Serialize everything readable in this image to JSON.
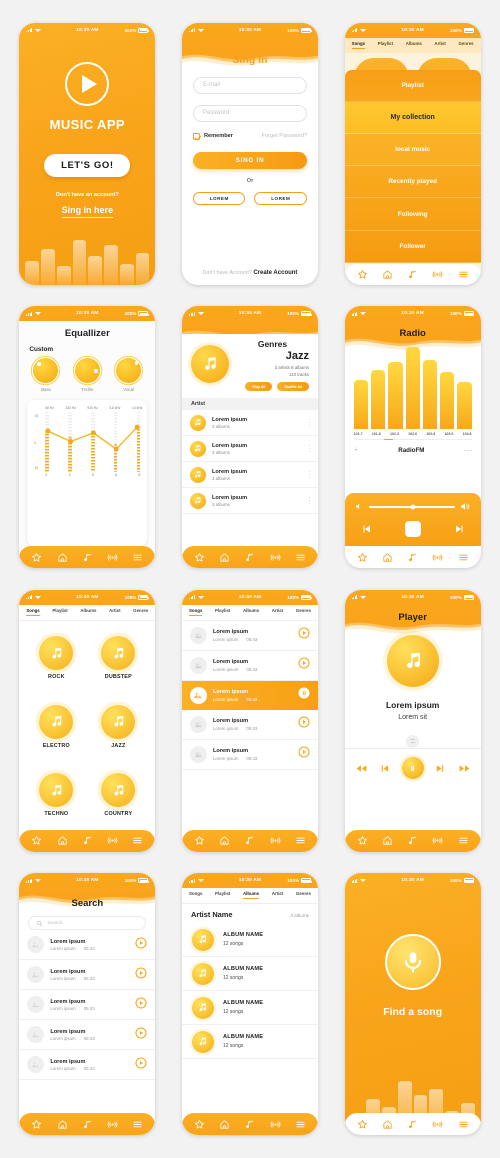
{
  "status_bar": {
    "time": "10:30 AM",
    "battery": "100%"
  },
  "nav": {
    "items": [
      {
        "name": "favorites",
        "icon": "star-icon"
      },
      {
        "name": "home",
        "icon": "home-icon"
      },
      {
        "name": "music",
        "icon": "music-note-icon"
      },
      {
        "name": "radio",
        "icon": "radio-waves-icon"
      },
      {
        "name": "menu",
        "icon": "hamburger-menu-icon"
      }
    ]
  },
  "tabs": [
    "Songs",
    "Playlist",
    "Albums",
    "Artist",
    "Genres"
  ],
  "splash": {
    "title": "MUSIC APP",
    "cta": "LET'S GO!",
    "sub": "Don't have an account?",
    "link": "Sing in here"
  },
  "signin": {
    "title": "Sing In",
    "email_placeholder": "E-mail",
    "password_placeholder": "Password",
    "remember": "Remember",
    "forgot": "Forget Password?",
    "submit": "SING IN",
    "or": "Or",
    "alt1": "LOREM",
    "alt2": "LOREM",
    "foot_text": "Don't have Account?",
    "foot_link": "Create Account"
  },
  "playlist_menu": {
    "active_tab": "Songs",
    "items": [
      {
        "label": "Playlist",
        "selected": false
      },
      {
        "label": "My collection",
        "selected": true
      },
      {
        "label": "local music",
        "selected": false
      },
      {
        "label": "Recently played",
        "selected": false
      },
      {
        "label": "Following",
        "selected": false
      },
      {
        "label": "Follower",
        "selected": false
      }
    ]
  },
  "equalizer": {
    "title": "Equallizer",
    "preset_label": "Custom",
    "knobs": [
      {
        "label": "Bass",
        "angle": -50
      },
      {
        "label": "Treble",
        "angle": 25
      },
      {
        "label": "Vocal",
        "angle": -15
      }
    ]
  },
  "genres_detail": {
    "title": "Genres",
    "name": "Jazz",
    "meta_line1": "3 artists 8 albums",
    "meta_line2": "110 tracks",
    "btn_play": "Play All",
    "btn_shuffle": "Shuffle All",
    "section": "Artist",
    "artists": [
      {
        "name": "Lorem ipsum",
        "sub": "3 albums"
      },
      {
        "name": "Lorem ipsum",
        "sub": "3 albums"
      },
      {
        "name": "Lorem ipsum",
        "sub": "3 albums"
      },
      {
        "name": "Lorem ipsum",
        "sub": "3 albums"
      }
    ]
  },
  "radio": {
    "title": "Radio",
    "station": "RadioFM",
    "frequencies": [
      "101.7",
      "101.8",
      "102.3",
      "102.6",
      "102.8",
      "103.6",
      "104.6"
    ]
  },
  "genre_grid": {
    "active_tab": "Songs",
    "items": [
      "ROCK",
      "DUBSTEP",
      "ELECTRO",
      "JAZZ",
      "TECHNO",
      "COUNTRY"
    ]
  },
  "song_list": {
    "active_tab": "Songs",
    "rows": [
      {
        "title": "Lorem ipsum",
        "artist": "Lorem ipsum",
        "time": "05:43",
        "playing": false
      },
      {
        "title": "Lorem ipsum",
        "artist": "Lorem ipsum",
        "time": "05:43",
        "playing": false
      },
      {
        "title": "Lorem ipsum",
        "artist": "Lorem ipsum",
        "time": "05:43",
        "playing": true
      },
      {
        "title": "Lorem ipsum",
        "artist": "Lorem ipsum",
        "time": "05:43",
        "playing": false
      },
      {
        "title": "Lorem ipsum",
        "artist": "Lorem ipsum",
        "time": "05:43",
        "playing": false
      }
    ]
  },
  "player": {
    "title": "Player",
    "track": "Lorem ipsum",
    "artist": "Lorem sit"
  },
  "search": {
    "title": "Search",
    "placeholder": "Search.",
    "rows": [
      {
        "title": "Lorem ipsum",
        "artist": "Lorem ipsum",
        "time": "05:43"
      },
      {
        "title": "Lorem ipsum",
        "artist": "Lorem ipsum",
        "time": "05:43"
      },
      {
        "title": "Lorem ipsum",
        "artist": "Lorem ipsum",
        "time": "05:43"
      },
      {
        "title": "Lorem ipsum",
        "artist": "Lorem ipsum",
        "time": "05:43"
      },
      {
        "title": "Lorem ipsum",
        "artist": "Lorem ipsum",
        "time": "05:43"
      }
    ]
  },
  "albums": {
    "active_tab": "Albums",
    "artist_name": "Artist Name",
    "count": "3 albums",
    "rows": [
      {
        "name": "ALBUM NAME",
        "songs": "12 songs"
      },
      {
        "name": "ALBUM NAME",
        "songs": "12 songs"
      },
      {
        "name": "ALBUM NAME",
        "songs": "12 songs"
      },
      {
        "name": "ALBUM NAME",
        "songs": "12 songs"
      }
    ]
  },
  "find_song": {
    "title": "Find a song"
  },
  "colors": {
    "orange": "#F6A01A",
    "orange_light": "#FBB026",
    "yellow": "#FFD740",
    "page_bg": "#F2F2F2"
  },
  "chart_data": {
    "type": "line",
    "title": "Equallizer",
    "categories": [
      "60 Hz",
      "230 Hz",
      "910 Hz",
      "3.6 kHz",
      "14 kHz"
    ],
    "values": [
      6,
      3,
      5,
      0,
      8
    ],
    "xticks": [
      "2",
      "3",
      "5",
      "6",
      "8"
    ],
    "yticks": [
      "15",
      "0",
      "15"
    ],
    "ylim": [
      -15,
      15
    ],
    "ylabel": "",
    "xlabel": ""
  }
}
